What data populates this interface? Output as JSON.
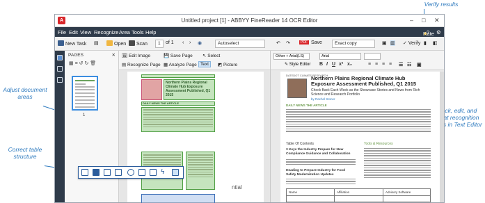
{
  "window": {
    "title": "Untitled project [1] - ABBYY FineReader 14 OCR Editor",
    "logo": "A"
  },
  "menu": {
    "items": [
      "File",
      "Edit",
      "View",
      "Recognize",
      "Area",
      "Tools",
      "Help"
    ],
    "rate_label": "Rate Us"
  },
  "toolbar": {
    "new_task": "New Task",
    "open": "Open",
    "scan": "Scan",
    "page_current": "1",
    "page_total": "of 1",
    "language": "Autoselect",
    "save": "Save",
    "save_mode": "Exact copy",
    "verify": "Verify"
  },
  "pages_panel": {
    "title": "PAGES",
    "thumb_number": "1"
  },
  "image_tools": {
    "edit_image": "Edit Image",
    "recognize_page": "Recognize Page",
    "save_page": "Save Page",
    "analyze_page": "Analyze Page",
    "select": "Select",
    "text": "Text",
    "picture": "Picture"
  },
  "image_page": {
    "headline": "Northern Plains Regional Climate Hub Exposure Assessment Published, Q1 2015",
    "subhead": "Check Back Each Week as the Showcase Stories and News from Rich Science and Research Portfolio",
    "section": "DAILY NEWS THE ARTICLE",
    "table_head": "Table Of Contents",
    "partial_word": "ntial"
  },
  "text_tools": {
    "style_dropdown": "Other + Arial(LS)",
    "font": "Arial",
    "style_editor": "Style Editor"
  },
  "text_page": {
    "topline": "DATEDOT CLIMATE RESEARCH",
    "headline": "Northern Plains Regional Climate Hub Exposure Assessment Published, Q1 2015",
    "subhead": "Check Back Each Week as the Showcase Stories and News from Rich Science and Research Portfolio",
    "byline": "by Rachel Stoner",
    "section": "DAILY NEWS THE ARTICLE",
    "toc": "Table Of Contents",
    "toc_right": "Tools & Resources",
    "item1": "3 Keys the Industry Prepare for New Compliance Guidance and Collaboration",
    "item2": "Heading to Prepare Industry for Food Safety Modernization Updates",
    "table_c1": "Name",
    "table_c2": "Affiliation",
    "table_c3": "Advisory Software"
  },
  "annotations": {
    "verify": "Verify results",
    "adjust": "Adjust document areas",
    "correct": "Correct table structure",
    "check": "Check, edit, and format recognition results in Text Editor"
  },
  "colors": {
    "menubar": "#2f3b4a",
    "accent": "#2f7bbf",
    "area_text": "#7fc46e",
    "area_picture": "#e88ca0",
    "area_table": "#78a0dc"
  }
}
